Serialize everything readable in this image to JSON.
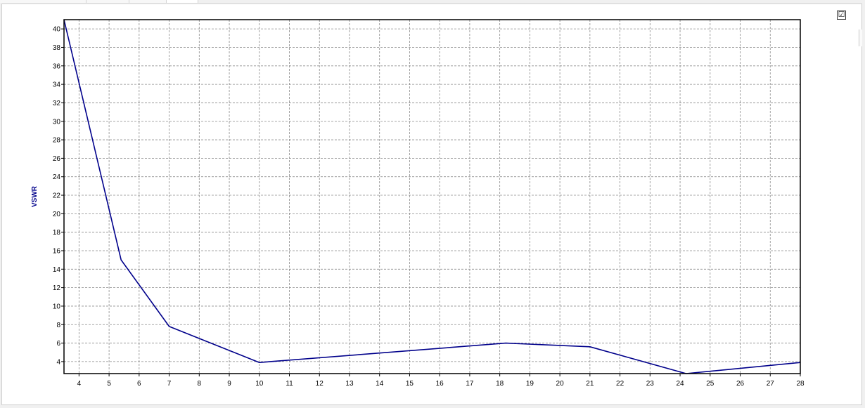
{
  "header": {
    "checkbox_mark": "☑"
  },
  "chart_data": {
    "type": "line",
    "title": "",
    "xlabel": "",
    "ylabel": "VSWR",
    "xlim": [
      3.5,
      28
    ],
    "ylim": [
      2.7,
      41
    ],
    "xticks": [
      4,
      5,
      6,
      7,
      8,
      9,
      10,
      11,
      12,
      13,
      14,
      15,
      16,
      17,
      18,
      19,
      20,
      21,
      22,
      23,
      24,
      25,
      26,
      27,
      28
    ],
    "yticks": [
      4,
      6,
      8,
      10,
      12,
      14,
      16,
      18,
      20,
      22,
      24,
      26,
      28,
      30,
      32,
      34,
      36,
      38,
      40
    ],
    "grid": true,
    "series": [
      {
        "color": "#00008b",
        "x": [
          3.5,
          5.4,
          7.0,
          10.0,
          18.2,
          21.0,
          24.2,
          28.0
        ],
        "y": [
          41.0,
          15.0,
          7.8,
          3.9,
          6.0,
          5.6,
          2.7,
          3.9
        ]
      }
    ]
  }
}
